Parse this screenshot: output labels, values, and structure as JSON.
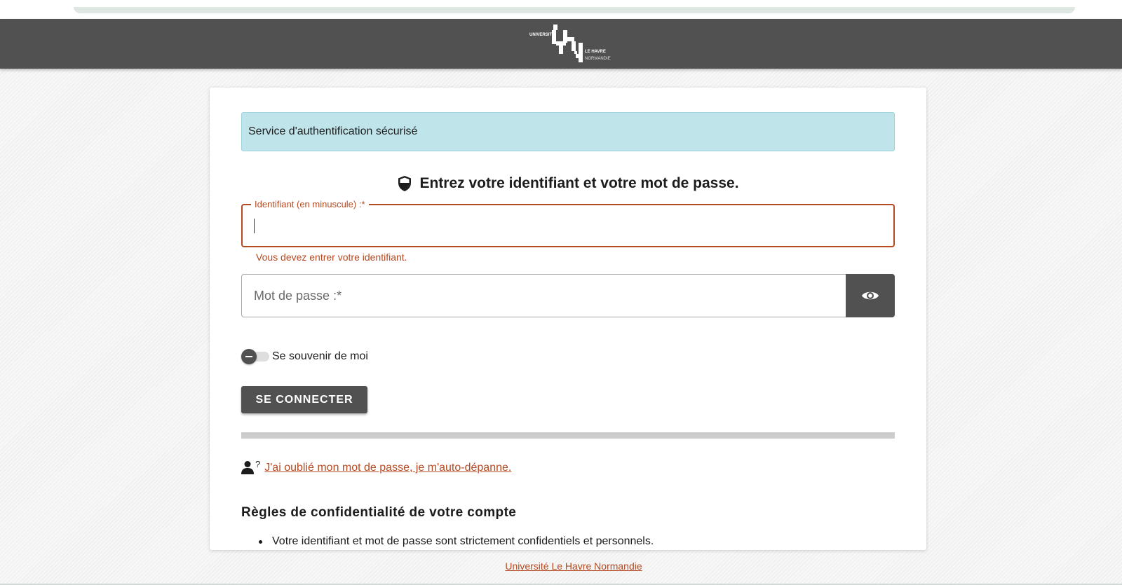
{
  "header": {
    "logo": {
      "line1": "UNIVERSITÉ",
      "line2": "LE HAVRE",
      "line3": "NORMANDIE",
      "icon": "university-logo"
    }
  },
  "login": {
    "banner": "Service d'authentification sécurisé",
    "heading": "Entrez votre identifiant et votre mot de passe.",
    "heading_icon": "shield-icon",
    "username": {
      "label": "Identifiant (en minuscule) :*",
      "value": "",
      "error": "Vous devez entrer votre identifiant."
    },
    "password": {
      "placeholder": "Mot de passe :*",
      "value": "",
      "toggle_icon": "eye-icon"
    },
    "remember": {
      "label": "Se souvenir de moi",
      "checked": false
    },
    "submit_label": "SE CONNECTER",
    "forgot": {
      "icon": "user-question-icon",
      "mark": "?",
      "link_text": "J'ai oublié mon mot de passe, je m'auto-dépanne."
    },
    "rules": {
      "title": "Règles de confidentialité de votre compte",
      "items": [
        "Votre identifiant et mot de passe sont strictement confidentiels et personnels."
      ]
    }
  },
  "footer": {
    "link_text": "Université Le Havre Normandie"
  },
  "colors": {
    "header_bg": "#515151",
    "accent_error": "#b54a22",
    "banner_bg": "#bfe4ea",
    "button_bg": "#515151"
  }
}
